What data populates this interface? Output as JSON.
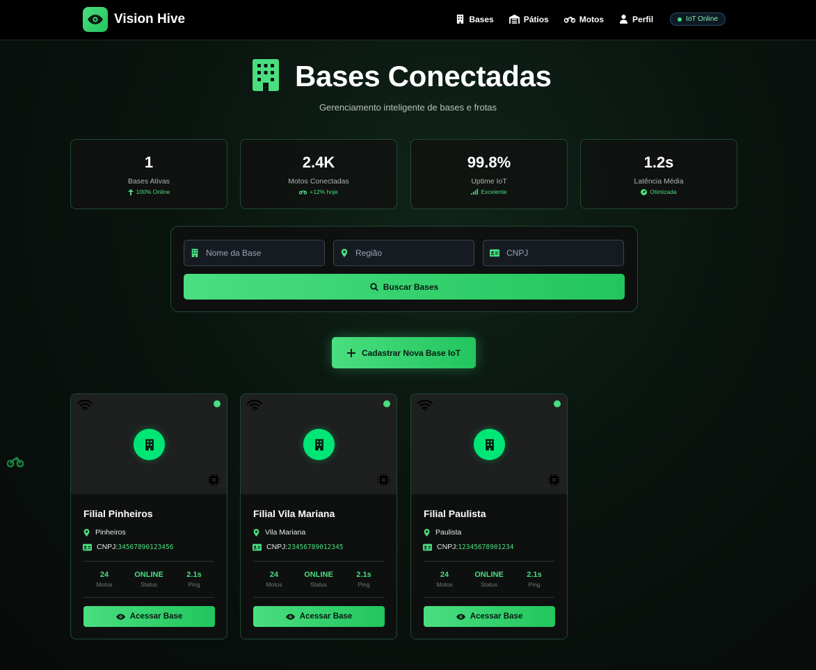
{
  "app": {
    "name": "Vision Hive",
    "nav": [
      {
        "label": "Bases",
        "icon": "building-icon"
      },
      {
        "label": "Pátios",
        "icon": "warehouse-icon"
      },
      {
        "label": "Motos",
        "icon": "motorcycle-icon"
      },
      {
        "label": "Perfil",
        "icon": "user-icon"
      }
    ],
    "iot_status": "IoT Online"
  },
  "hero": {
    "title": "Bases Conectadas",
    "subtitle": "Gerenciamento inteligente de bases e frotas"
  },
  "stats": [
    {
      "value": "1",
      "label": "Bases Ativas",
      "sub": "100% Online",
      "sub_icon": "arrow-up-icon"
    },
    {
      "value": "2.4K",
      "label": "Motos Conectadas",
      "sub": "+12% hoje",
      "sub_icon": "motorcycle-icon"
    },
    {
      "value": "99.8%",
      "label": "Uptime IoT",
      "sub": "Excelente",
      "sub_icon": "signal-icon"
    },
    {
      "value": "1.2s",
      "label": "Latência Média",
      "sub": "Otimizada",
      "sub_icon": "gauge-icon"
    }
  ],
  "search": {
    "name_placeholder": "Nome da Base",
    "region_placeholder": "Região",
    "cnpj_placeholder": "CNPJ",
    "button_label": "Buscar Bases"
  },
  "cta_label": "Cadastrar Nova Base IoT",
  "bases": [
    {
      "name": "Filial Pinheiros",
      "region": "Pinheiros",
      "cnpj_prefix": "CNPJ:",
      "cnpj": "34567890123456",
      "motos": "24",
      "motos_label": "Motos",
      "status": "ONLINE",
      "status_label": "Status",
      "ping": "2.1s",
      "ping_label": "Ping",
      "button": "Acessar Base"
    },
    {
      "name": "Filial Vila Mariana",
      "region": "Vila Mariana",
      "cnpj_prefix": "CNPJ:",
      "cnpj": "23456789012345",
      "motos": "24",
      "motos_label": "Motos",
      "status": "ONLINE",
      "status_label": "Status",
      "ping": "2.1s",
      "ping_label": "Ping",
      "button": "Acessar Base"
    },
    {
      "name": "Filial Paulista",
      "region": "Paulista",
      "cnpj_prefix": "CNPJ:",
      "cnpj": "12345678901234",
      "motos": "24",
      "motos_label": "Motos",
      "status": "ONLINE",
      "status_label": "Status",
      "ping": "2.1s",
      "ping_label": "Ping",
      "button": "Acessar Base"
    }
  ],
  "colors": {
    "accent": "#4ade80",
    "accent_dark": "#22c55e",
    "status_online": "#00e676"
  }
}
